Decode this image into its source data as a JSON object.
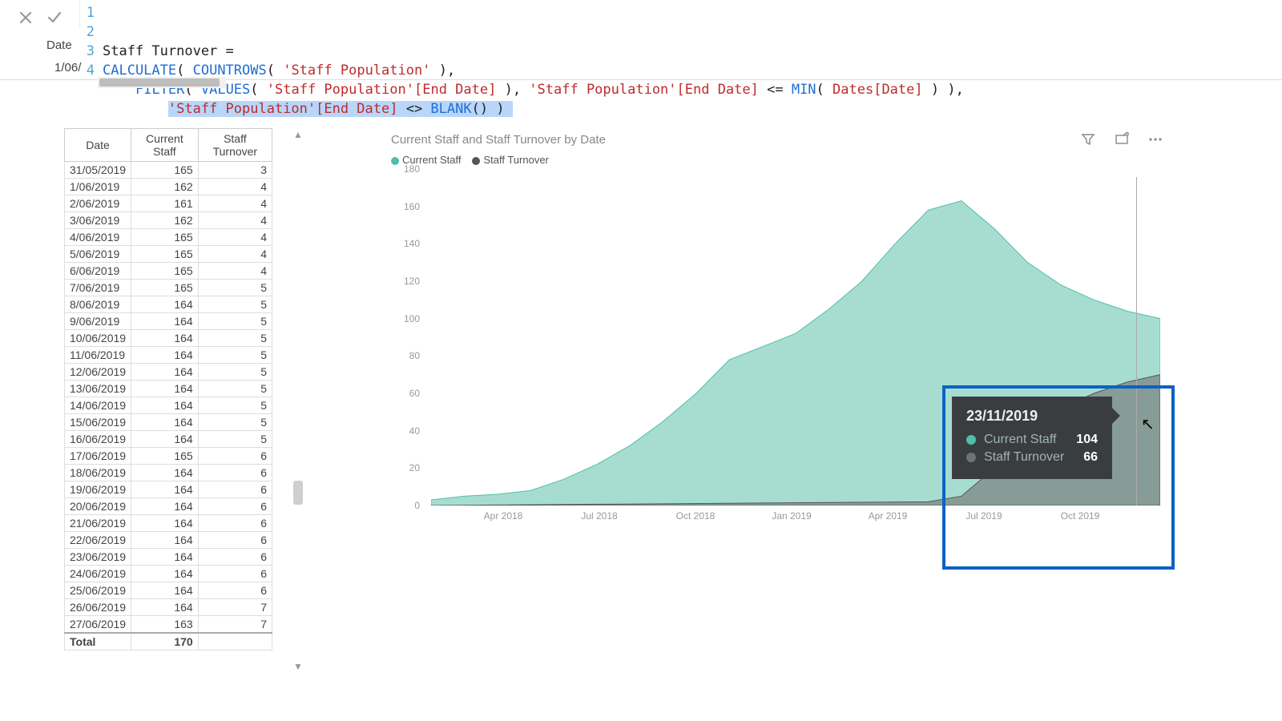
{
  "formula": {
    "slicer_label": "Date",
    "slicer_value": "1/06/",
    "lines": [
      {
        "no": "1",
        "segments": [
          {
            "t": "Staff Turnover = ",
            "c": "tok-black"
          }
        ]
      },
      {
        "no": "2",
        "segments": [
          {
            "t": "CALCULATE",
            "c": "tok-blue"
          },
          {
            "t": "( ",
            "c": "tok-black"
          },
          {
            "t": "COUNTROWS",
            "c": "tok-blue"
          },
          {
            "t": "( ",
            "c": "tok-black"
          },
          {
            "t": "'Staff Population'",
            "c": "tok-red"
          },
          {
            "t": " ),",
            "c": "tok-black"
          }
        ]
      },
      {
        "no": "3",
        "segments": [
          {
            "t": "    ",
            "c": "tok-black"
          },
          {
            "t": "FILTER",
            "c": "tok-blue"
          },
          {
            "t": "( ",
            "c": "tok-black"
          },
          {
            "t": "VALUES",
            "c": "tok-blue"
          },
          {
            "t": "( ",
            "c": "tok-black"
          },
          {
            "t": "'Staff Population'[End Date]",
            "c": "tok-red"
          },
          {
            "t": " ), ",
            "c": "tok-black"
          },
          {
            "t": "'Staff Population'[End Date]",
            "c": "tok-red"
          },
          {
            "t": " <= ",
            "c": "tok-black"
          },
          {
            "t": "MIN",
            "c": "tok-blue"
          },
          {
            "t": "( ",
            "c": "tok-black"
          },
          {
            "t": "Dates[Date]",
            "c": "tok-red"
          },
          {
            "t": " ) ),",
            "c": "tok-black"
          }
        ]
      },
      {
        "no": "4",
        "segments": [
          {
            "t": "        ",
            "c": "tok-black"
          },
          {
            "t": "'Staff Population'[End Date]",
            "c": "tok-red hl-select"
          },
          {
            "t": " <> ",
            "c": "tok-black hl-select"
          },
          {
            "t": "BLANK",
            "c": "tok-blue hl-select"
          },
          {
            "t": "() ) ",
            "c": "tok-black hl-select"
          }
        ]
      }
    ]
  },
  "table": {
    "headers": [
      "Date",
      "Current Staff",
      "Staff Turnover"
    ],
    "rows": [
      [
        "31/05/2019",
        "165",
        "3"
      ],
      [
        "1/06/2019",
        "162",
        "4"
      ],
      [
        "2/06/2019",
        "161",
        "4"
      ],
      [
        "3/06/2019",
        "162",
        "4"
      ],
      [
        "4/06/2019",
        "165",
        "4"
      ],
      [
        "5/06/2019",
        "165",
        "4"
      ],
      [
        "6/06/2019",
        "165",
        "4"
      ],
      [
        "7/06/2019",
        "165",
        "5"
      ],
      [
        "8/06/2019",
        "164",
        "5"
      ],
      [
        "9/06/2019",
        "164",
        "5"
      ],
      [
        "10/06/2019",
        "164",
        "5"
      ],
      [
        "11/06/2019",
        "164",
        "5"
      ],
      [
        "12/06/2019",
        "164",
        "5"
      ],
      [
        "13/06/2019",
        "164",
        "5"
      ],
      [
        "14/06/2019",
        "164",
        "5"
      ],
      [
        "15/06/2019",
        "164",
        "5"
      ],
      [
        "16/06/2019",
        "164",
        "5"
      ],
      [
        "17/06/2019",
        "165",
        "6"
      ],
      [
        "18/06/2019",
        "164",
        "6"
      ],
      [
        "19/06/2019",
        "164",
        "6"
      ],
      [
        "20/06/2019",
        "164",
        "6"
      ],
      [
        "21/06/2019",
        "164",
        "6"
      ],
      [
        "22/06/2019",
        "164",
        "6"
      ],
      [
        "23/06/2019",
        "164",
        "6"
      ],
      [
        "24/06/2019",
        "164",
        "6"
      ],
      [
        "25/06/2019",
        "164",
        "6"
      ],
      [
        "26/06/2019",
        "164",
        "7"
      ],
      [
        "27/06/2019",
        "163",
        "7"
      ]
    ],
    "total_label": "Total",
    "total_value": "170"
  },
  "chart": {
    "title": "Current Staff and Staff Turnover by Date",
    "legend": {
      "series1": "Current Staff",
      "series2": "Staff Turnover"
    },
    "tooltip": {
      "date": "23/11/2019",
      "rows": [
        {
          "name": "Current Staff",
          "val": "104",
          "color": "#4fbfa8"
        },
        {
          "name": "Staff Turnover",
          "val": "66",
          "color": "#6c7573"
        }
      ]
    },
    "yticks": [
      "0",
      "20",
      "40",
      "60",
      "80",
      "100",
      "120",
      "140",
      "160",
      "180"
    ],
    "xticks": [
      "Apr 2018",
      "Jul 2018",
      "Oct 2018",
      "Jan 2019",
      "Apr 2019",
      "Jul 2019",
      "Oct 2019"
    ]
  },
  "chart_data": {
    "type": "area",
    "title": "Current Staff and Staff Turnover by Date",
    "xlabel": "Date",
    "ylabel": "",
    "ylim": [
      0,
      180
    ],
    "legend_position": "top-left",
    "series": [
      {
        "name": "Current Staff",
        "color": "#4fbfa8",
        "points": [
          {
            "x": "Feb 2018",
            "y": 3
          },
          {
            "x": "Mar 2018",
            "y": 5
          },
          {
            "x": "Apr 2018",
            "y": 6
          },
          {
            "x": "May 2018",
            "y": 8
          },
          {
            "x": "Jun 2018",
            "y": 14
          },
          {
            "x": "Jul 2018",
            "y": 22
          },
          {
            "x": "Aug 2018",
            "y": 32
          },
          {
            "x": "Sep 2018",
            "y": 45
          },
          {
            "x": "Oct 2018",
            "y": 60
          },
          {
            "x": "Nov 2018",
            "y": 78
          },
          {
            "x": "Dec 2018",
            "y": 85
          },
          {
            "x": "Jan 2019",
            "y": 92
          },
          {
            "x": "Feb 2019",
            "y": 105
          },
          {
            "x": "Mar 2019",
            "y": 120
          },
          {
            "x": "Apr 2019",
            "y": 140
          },
          {
            "x": "May 2019",
            "y": 158
          },
          {
            "x": "Jun 2019",
            "y": 163
          },
          {
            "x": "Jul 2019",
            "y": 148
          },
          {
            "x": "Aug 2019",
            "y": 130
          },
          {
            "x": "Sep 2019",
            "y": 118
          },
          {
            "x": "Oct 2019",
            "y": 110
          },
          {
            "x": "Nov 2019",
            "y": 104
          },
          {
            "x": "Dec 2019",
            "y": 100
          }
        ]
      },
      {
        "name": "Staff Turnover",
        "color": "#6c7573",
        "points": [
          {
            "x": "Feb 2018",
            "y": 0
          },
          {
            "x": "May 2019",
            "y": 2
          },
          {
            "x": "Jun 2019",
            "y": 5
          },
          {
            "x": "Jul 2019",
            "y": 20
          },
          {
            "x": "Aug 2019",
            "y": 40
          },
          {
            "x": "Sep 2019",
            "y": 52
          },
          {
            "x": "Oct 2019",
            "y": 60
          },
          {
            "x": "Nov 2019",
            "y": 66
          },
          {
            "x": "Dec 2019",
            "y": 70
          }
        ]
      }
    ],
    "tooltip_sample": {
      "date": "23/11/2019",
      "Current Staff": 104,
      "Staff Turnover": 66
    }
  }
}
